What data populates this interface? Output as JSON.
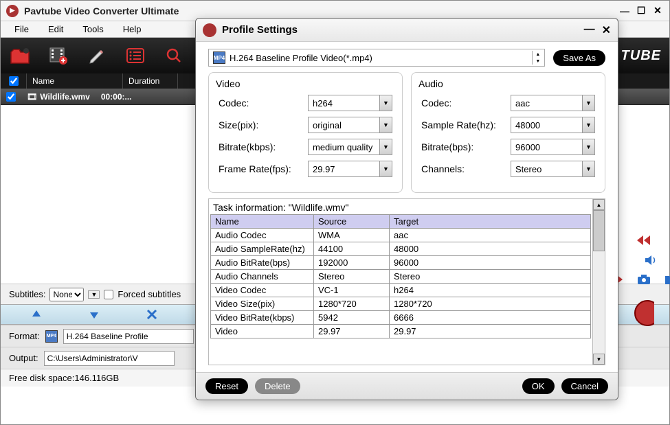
{
  "app": {
    "title": "Pavtube Video Converter Ultimate",
    "brand": "TUBE"
  },
  "menubar": [
    "File",
    "Edit",
    "Tools",
    "Help"
  ],
  "list": {
    "headers": {
      "name": "Name",
      "duration": "Duration"
    },
    "rows": [
      {
        "name": "Wildlife.wmv",
        "duration": "00:00:..."
      }
    ]
  },
  "subtitles": {
    "label": "Subtitles:",
    "value": "None",
    "forced": "Forced subtitles"
  },
  "format": {
    "label": "Format:",
    "value": "H.264 Baseline Profile"
  },
  "output": {
    "label": "Output:",
    "value": "C:\\Users\\Administrator\\V"
  },
  "status": {
    "free_space": "Free disk space:146.116GB"
  },
  "dialog": {
    "title": "Profile Settings",
    "profile": "H.264 Baseline Profile Video(*.mp4)",
    "save_as": "Save As",
    "video": {
      "title": "Video",
      "codec_label": "Codec:",
      "codec": "h264",
      "size_label": "Size(pix):",
      "size": "original",
      "bitrate_label": "Bitrate(kbps):",
      "bitrate": "medium quality",
      "fps_label": "Frame Rate(fps):",
      "fps": "29.97"
    },
    "audio": {
      "title": "Audio",
      "codec_label": "Codec:",
      "codec": "aac",
      "sr_label": "Sample Rate(hz):",
      "sr": "48000",
      "bitrate_label": "Bitrate(bps):",
      "bitrate": "96000",
      "ch_label": "Channels:",
      "ch": "Stereo"
    },
    "task_title": "Task information: \"Wildlife.wmv\"",
    "task_headers": {
      "name": "Name",
      "source": "Source",
      "target": "Target"
    },
    "task_rows": [
      {
        "name": "Audio Codec",
        "source": "WMA",
        "target": "aac"
      },
      {
        "name": "Audio SampleRate(hz)",
        "source": "44100",
        "target": "48000"
      },
      {
        "name": "Audio BitRate(bps)",
        "source": "192000",
        "target": "96000"
      },
      {
        "name": "Audio Channels",
        "source": "Stereo",
        "target": "Stereo"
      },
      {
        "name": "Video Codec",
        "source": "VC-1",
        "target": "h264"
      },
      {
        "name": "Video Size(pix)",
        "source": "1280*720",
        "target": "1280*720"
      },
      {
        "name": "Video BitRate(kbps)",
        "source": "5942",
        "target": "6666"
      },
      {
        "name": "Video",
        "source": "29.97",
        "target": "29.97"
      }
    ],
    "buttons": {
      "reset": "Reset",
      "delete": "Delete",
      "ok": "OK",
      "cancel": "Cancel"
    }
  }
}
